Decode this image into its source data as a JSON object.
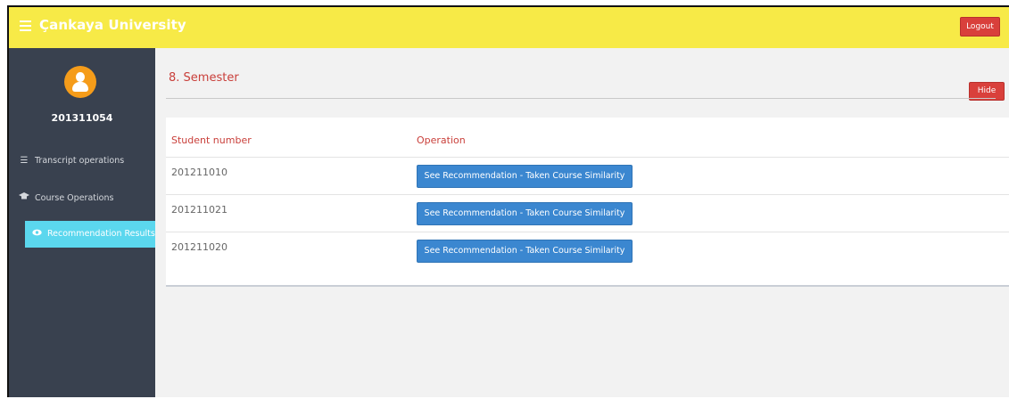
{
  "header": {
    "brand": "Çankaya University",
    "logout_label": "Logout",
    "bg_color": "#f7ea47"
  },
  "sidebar": {
    "user_id": "201311054",
    "items": [
      {
        "label": "Transcript operations",
        "icon": "list-icon"
      },
      {
        "label": "Course Operations",
        "icon": "graduation-cap-icon"
      },
      {
        "label": "Recommendation Results",
        "icon": "eye-icon",
        "active": true
      }
    ]
  },
  "main": {
    "section_title": "8. Semester",
    "hide_label": "Hide",
    "table": {
      "columns": [
        "Student number",
        "Operation"
      ],
      "rows": [
        {
          "student_number": "201211010",
          "operation": "See Recommendation - Taken Course Similarity"
        },
        {
          "student_number": "201211021",
          "operation": "See Recommendation - Taken Course Similarity"
        },
        {
          "student_number": "201211020",
          "operation": "See Recommendation - Taken Course Similarity"
        }
      ]
    }
  },
  "colors": {
    "accent_red": "#c93f3a",
    "button_blue": "#3b87d0",
    "sidebar_bg": "#39414f",
    "active_item": "#5bd7ee"
  }
}
